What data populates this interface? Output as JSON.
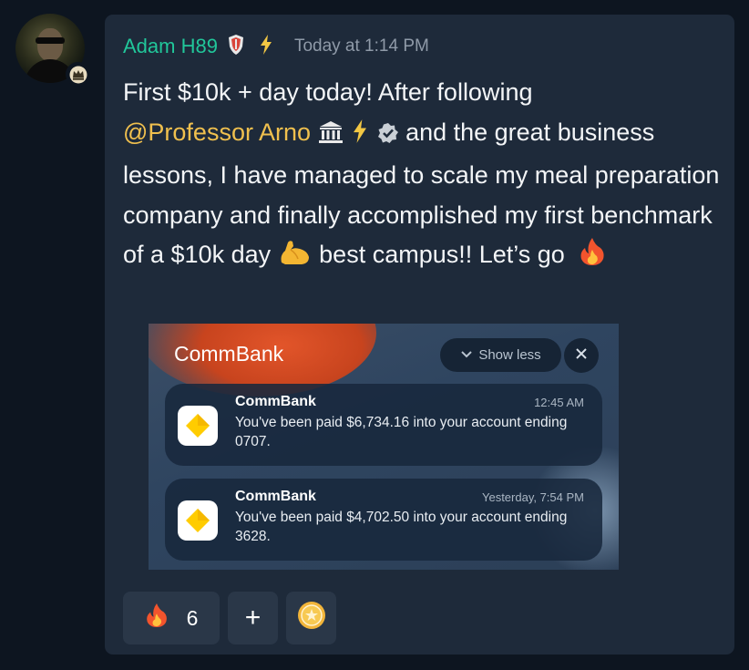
{
  "author": {
    "name": "Adam H89",
    "timestamp": "Today at 1:14 PM",
    "role_icons": [
      "shield-icon",
      "lightning-icon"
    ],
    "avatar_badge": "crown-icon"
  },
  "message": {
    "text_before_mention": "First $10k + day today! After following",
    "mention": "@Professor Arno",
    "mention_icons": [
      "bank-icon",
      "lightning-icon",
      "verified-icon"
    ],
    "text_after_mention": " and the great business lessons, I have managed to scale my meal preparation company and finally accomplished my first benchmark of a $10k day",
    "text_after_flex": " best campus!! Let’s go",
    "emojis": [
      "flexed-biceps-icon",
      "fire-icon"
    ]
  },
  "attachment": {
    "bank_header": "CommBank",
    "show_less_label": "Show less",
    "notifications": [
      {
        "app": "CommBank",
        "time": "12:45 AM",
        "body": "You've been paid $6,734.16 into your account ending 0707."
      },
      {
        "app": "CommBank",
        "time": "Yesterday, 7:54 PM",
        "body": "You've been paid $4,702.50 into your account ending 3628."
      }
    ]
  },
  "reactions": [
    {
      "icon": "fire-icon",
      "count": "6"
    },
    {
      "icon": "plus-icon",
      "label": "+"
    },
    {
      "icon": "coin-icon"
    }
  ],
  "colors": {
    "background": "#0d1520",
    "card": "#1e2a3a",
    "username": "#21c79a",
    "mention": "#f0c04e",
    "timestamp": "#8f9aa8",
    "commbank_yellow": "#ffcc00"
  }
}
